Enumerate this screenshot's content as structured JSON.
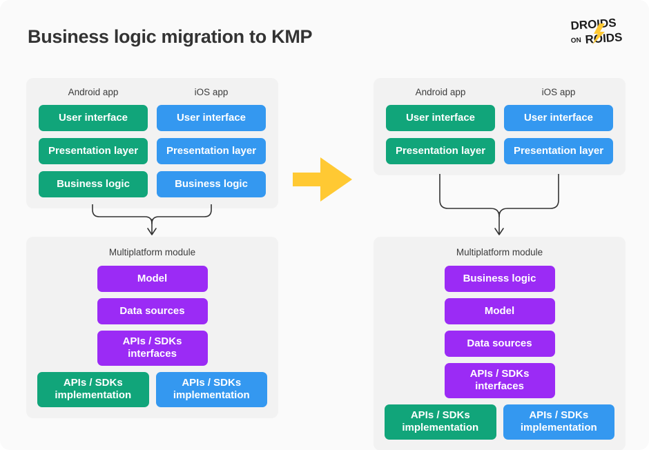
{
  "page": {
    "title": "Business logic migration to KMP",
    "background": "#fafafa"
  },
  "logo": {
    "name": "droids-on-roids-logo",
    "line1": "DROIDS",
    "line2_small": "ON",
    "line2": "ROIDS",
    "bolt_color": "#FFC933",
    "text_color": "#1b1b1b"
  },
  "colors": {
    "android_green": "#11a57a",
    "ios_blue": "#3498f0",
    "shared_purple": "#9b2bf5",
    "panel_gray": "#f2f2f2",
    "arrow_yellow": "#FFC933",
    "connector_stroke": "#333333",
    "label_text": "#3b3b3b",
    "title_text": "#333333"
  },
  "center_arrow": {
    "name": "migration-arrow",
    "direction": "right",
    "color": "#FFC933"
  },
  "before": {
    "name": "before-state",
    "apps_panel": {
      "columns": [
        {
          "platform": "Android app",
          "color": "green",
          "blocks": [
            "User interface",
            "Presentation layer",
            "Business logic"
          ]
        },
        {
          "platform": "iOS app",
          "color": "blue",
          "blocks": [
            "User interface",
            "Presentation layer",
            "Business logic"
          ]
        }
      ]
    },
    "module_panel": {
      "label": "Multiplatform module",
      "shared_blocks": [
        "Model",
        "Data sources",
        "APIs / SDKs interfaces"
      ],
      "impl_blocks": [
        {
          "label": "APIs / SDKs implementation",
          "color": "green"
        },
        {
          "label": "APIs / SDKs implementation",
          "color": "blue"
        }
      ]
    }
  },
  "after": {
    "name": "after-state",
    "apps_panel": {
      "columns": [
        {
          "platform": "Android app",
          "color": "green",
          "blocks": [
            "User interface",
            "Presentation layer"
          ]
        },
        {
          "platform": "iOS app",
          "color": "blue",
          "blocks": [
            "User interface",
            "Presentation layer"
          ]
        }
      ]
    },
    "module_panel": {
      "label": "Multiplatform module",
      "shared_blocks": [
        "Business logic",
        "Model",
        "Data sources",
        "APIs / SDKs interfaces"
      ],
      "impl_blocks": [
        {
          "label": "APIs / SDKs implementation",
          "color": "green"
        },
        {
          "label": "APIs / SDKs implementation",
          "color": "blue"
        }
      ]
    }
  }
}
